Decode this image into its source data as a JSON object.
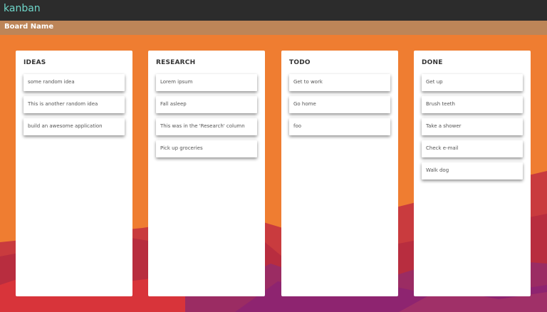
{
  "app": {
    "title": "kanban"
  },
  "board": {
    "name": "Board Name"
  },
  "columns": [
    {
      "title": "IDEAS",
      "cards": [
        "some random idea",
        "This is another random idea",
        "build an awesome application"
      ]
    },
    {
      "title": "RESEARCH",
      "cards": [
        "Lorem ipsum",
        "Fall asleep",
        "This was in the 'Research' column",
        "Pick up groceries"
      ]
    },
    {
      "title": "TODO",
      "cards": [
        "Get to work",
        "Go home",
        "foo"
      ]
    },
    {
      "title": "DONE",
      "cards": [
        "Get up",
        "Brush teeth",
        "Take a shower",
        "Check e-mail",
        "Walk dog"
      ]
    }
  ],
  "colors": {
    "topbar": "#2c2c2c",
    "title": "#6fd6c9",
    "boardbar": "#bd8558",
    "background": "#ef7d31"
  }
}
